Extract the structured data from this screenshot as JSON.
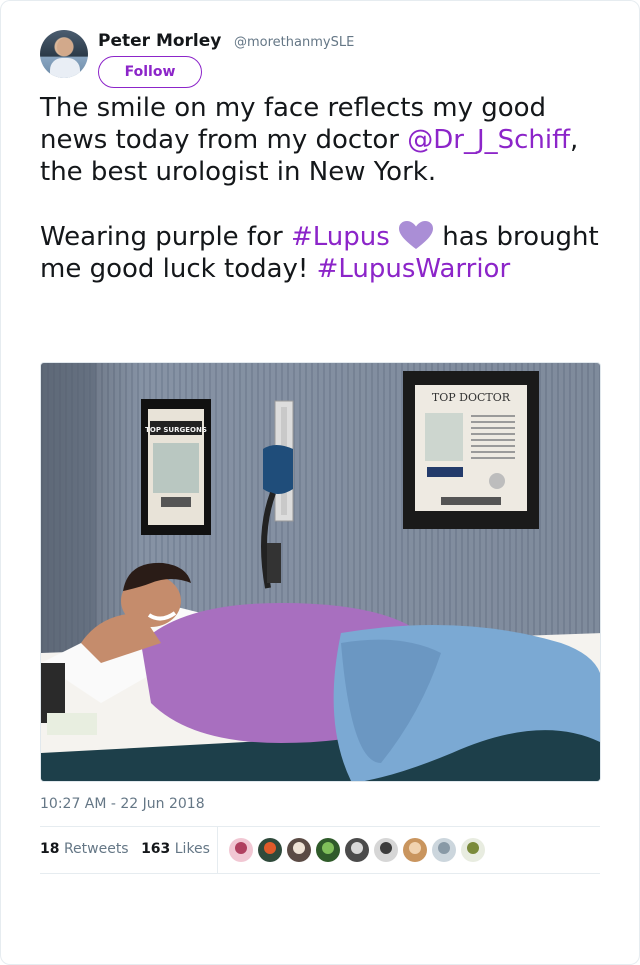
{
  "user": {
    "name": "Peter Morley",
    "handle": "@morethanmySLE",
    "follow_label": "Follow"
  },
  "tweet": {
    "segments": [
      {
        "text": "The smile on my face reflects my good news today from my doctor ",
        "type": "text"
      },
      {
        "text": "@Dr_J_Schiff",
        "type": "link"
      },
      {
        "text": ", the best urologist in New York.\n\nWearing purple for ",
        "type": "text"
      },
      {
        "text": "#Lupus",
        "type": "link"
      },
      {
        "text": " ",
        "type": "text"
      },
      {
        "text": "heart-icon",
        "type": "emoji"
      },
      {
        "text": " has brought me good luck today! ",
        "type": "text"
      },
      {
        "text": "#LupusWarrior",
        "type": "link"
      }
    ],
    "photo_signs": {
      "left_frame": "TOP SURGEONS",
      "right_frame": "TOP DOCTOR"
    },
    "timestamp": "10:27 AM - 22 Jun 2018"
  },
  "stats": {
    "retweets_count": "18",
    "retweets_label": "Retweets",
    "likes_count": "163",
    "likes_label": "Likes"
  },
  "likers": [
    {
      "name": "liker-1",
      "bg": "#f1c7d3",
      "fg": "#b0405f"
    },
    {
      "name": "liker-2",
      "bg": "#2f4a3b",
      "fg": "#e05a2a"
    },
    {
      "name": "liker-3",
      "bg": "#5b4b45",
      "fg": "#efe3d6"
    },
    {
      "name": "liker-4",
      "bg": "#2f5b2a",
      "fg": "#7fbf5a"
    },
    {
      "name": "liker-5",
      "bg": "#4b4b4b",
      "fg": "#d8d8d8"
    },
    {
      "name": "liker-6",
      "bg": "#d6d6d6",
      "fg": "#3c3c3c"
    },
    {
      "name": "liker-7",
      "bg": "#c9955e",
      "fg": "#f1d3b0"
    },
    {
      "name": "liker-8",
      "bg": "#ccd6dd",
      "fg": "#8899a6"
    },
    {
      "name": "liker-9",
      "bg": "#e8ece0",
      "fg": "#7a8a3a"
    }
  ],
  "colors": {
    "accent": "#8c25c9",
    "heart": "#aa8ed6",
    "muted": "#657786"
  }
}
